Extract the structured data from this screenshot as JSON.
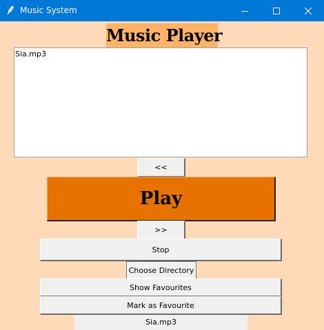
{
  "window": {
    "title": "Music System",
    "app_icon": "feather-icon",
    "controls": [
      "minimize-icon",
      "maximize-icon",
      "close-icon"
    ],
    "titlebar_color": "#0078d7"
  },
  "heading": "Music Player",
  "playlist": {
    "items": [
      "Sia.mp3"
    ]
  },
  "buttons": {
    "prev": "<<",
    "play": "Play",
    "next": ">>",
    "stop": "Stop",
    "choose_directory": "Choose Directory",
    "show_favourites": "Show Favourites",
    "mark_favourite": "Mark as Favourite"
  },
  "status": "Sia.mp3",
  "colors": {
    "background": "#ffdab9",
    "heading_bg": "#ffb366",
    "play_button": "#e77200"
  }
}
